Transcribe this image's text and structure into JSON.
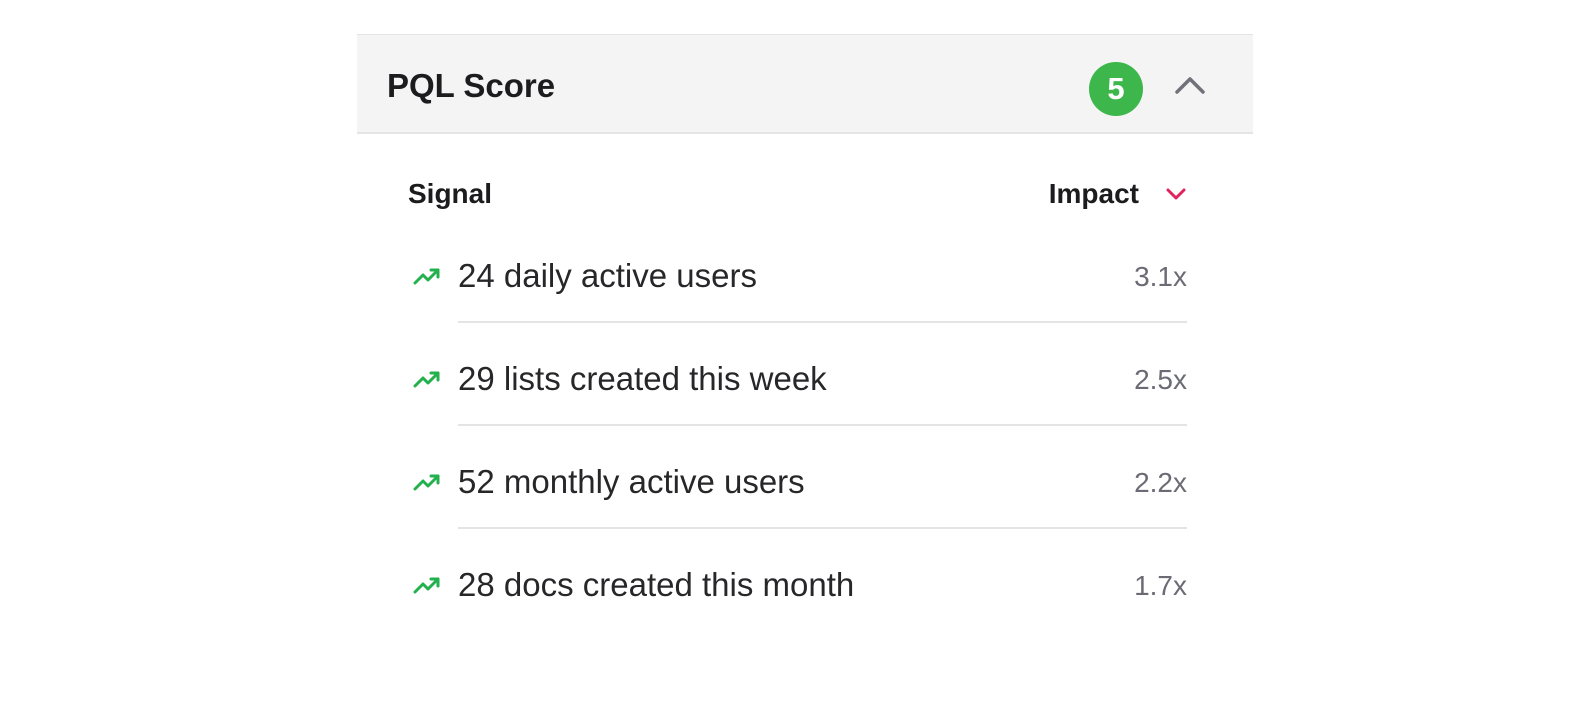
{
  "panel": {
    "title": "PQL Score",
    "score": "5",
    "accent_green": "#3db64b",
    "sort_accent": "#e0245e"
  },
  "table": {
    "col_signal": "Signal",
    "col_impact": "Impact",
    "rows": [
      {
        "signal": "24 daily active users",
        "impact": "3.1x",
        "icon": "trending-up-icon"
      },
      {
        "signal": "29 lists created this week",
        "impact": "2.5x",
        "icon": "trending-up-icon"
      },
      {
        "signal": "52 monthly active users",
        "impact": "2.2x",
        "icon": "trending-up-icon"
      },
      {
        "signal": "28 docs created this month",
        "impact": "1.7x",
        "icon": "trending-up-icon"
      }
    ]
  }
}
